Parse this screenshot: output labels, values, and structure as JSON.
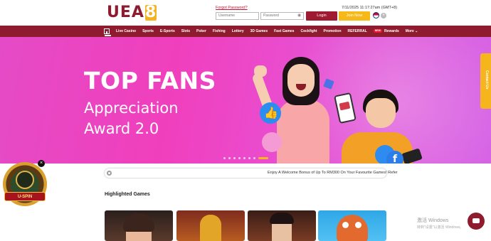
{
  "header": {
    "logo_text": "UEA",
    "logo_digit": "8",
    "forgot_password": "Forgot Password?",
    "datetime": "7/11/2025 11:17:27am (GMT+8)",
    "username_placeholder": "Username",
    "password_placeholder": "Password",
    "login_label": "Login",
    "join_label": "Join Now"
  },
  "nav": {
    "items": [
      "Live Casino",
      "Sports",
      "E-Sports",
      "Slots",
      "Poker",
      "Fishing",
      "Lottery",
      "3D Games",
      "Fast Games",
      "Cockfight",
      "Promotion",
      "REFERRAL"
    ],
    "rewards_badge": "NEW",
    "rewards": "Rewards",
    "more": "More",
    "more_chevron": "⌄"
  },
  "banner": {
    "title": "TOP FANS",
    "subtitle_line1": "Appreciation",
    "subtitle_line2": "Award 2.0",
    "fb_glyph": "f"
  },
  "contact_tab": "Contact Us",
  "marquee": {
    "text": "Enjoy A Welcome Bonus of Up To RM300 On Your Favourite Games! Refer"
  },
  "section": {
    "highlighted_games": "Highlighted Games"
  },
  "uspin": {
    "label": "U-SPIN",
    "close": "×"
  },
  "watermark": {
    "line1": "激活 Windows",
    "line2": "转到\"设置\"以激活 Windows。"
  },
  "colors": {
    "brand": "#8e1b2e",
    "accent": "#f7b918",
    "banner": "#f03fbd"
  }
}
